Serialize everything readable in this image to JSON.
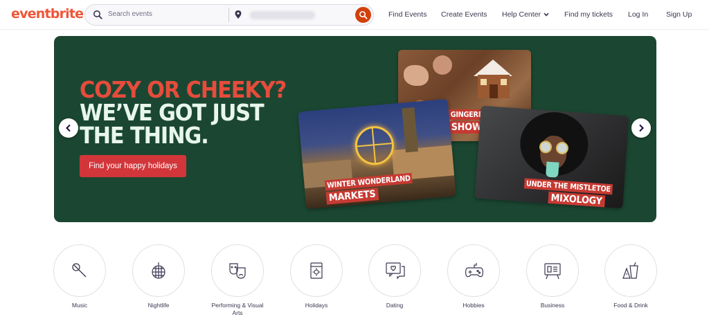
{
  "brand": {
    "logo_text": "eventbrite",
    "logo_color": "#f05537"
  },
  "search": {
    "placeholder": "Search events",
    "search_icon": "search-icon",
    "location_icon": "location-pin-icon",
    "submit_icon": "search-icon",
    "accent": "#d1410c"
  },
  "nav": {
    "find_events": "Find Events",
    "create_events": "Create Events",
    "help_center": "Help Center",
    "find_tickets": "Find my tickets",
    "log_in": "Log In",
    "sign_up": "Sign Up"
  },
  "hero": {
    "line1": "COZY OR CHEEKY?",
    "line2": "WE’VE GOT JUST",
    "line3": "THE THING.",
    "cta": "Find  your happy holidays",
    "background": "#1b4732",
    "cards": [
      {
        "top": "GINGERBREAD",
        "bottom": "SHOWDOWNS"
      },
      {
        "top": "WINTER WONDERLAND",
        "bottom": "MARKETS"
      },
      {
        "top": "UNDER THE MISTLETOE",
        "bottom": "MIXOLOGY"
      }
    ],
    "carousel": {
      "slides": 3,
      "active": 3
    }
  },
  "categories": [
    {
      "label": "Music",
      "icon": "microphone-icon"
    },
    {
      "label": "Nightlife",
      "icon": "disco-ball-icon"
    },
    {
      "label": "Performing & Visual Arts",
      "icon": "theater-masks-icon"
    },
    {
      "label": "Holidays",
      "icon": "calendar-sun-icon"
    },
    {
      "label": "Dating",
      "icon": "chat-heart-icon"
    },
    {
      "label": "Hobbies",
      "icon": "gamepad-icon"
    },
    {
      "label": "Business",
      "icon": "presentation-board-icon"
    },
    {
      "label": "Food & Drink",
      "icon": "food-drink-icon"
    }
  ]
}
